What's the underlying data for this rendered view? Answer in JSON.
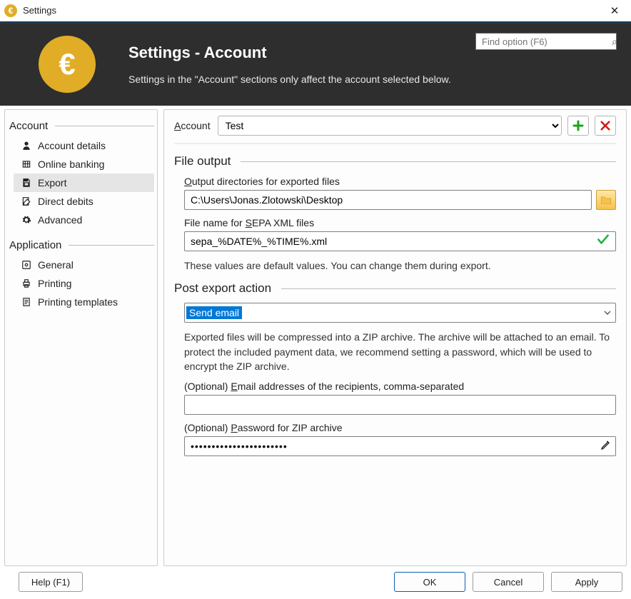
{
  "window": {
    "title": "Settings",
    "close_glyph": "✕"
  },
  "header": {
    "coin_glyph": "€",
    "title": "Settings - Account",
    "description": "Settings in the \"Account\" sections only affect the account selected below.",
    "find_placeholder": "Find option (F6)"
  },
  "sidebar": {
    "group_account": "Account",
    "group_application": "Application",
    "items_account": [
      {
        "label": "Account details"
      },
      {
        "label": "Online banking"
      },
      {
        "label": "Export"
      },
      {
        "label": "Direct debits"
      },
      {
        "label": "Advanced"
      }
    ],
    "items_application": [
      {
        "label": "General"
      },
      {
        "label": "Printing"
      },
      {
        "label": "Printing templates"
      }
    ]
  },
  "content": {
    "account_label_prefix": "A",
    "account_label_rest": "ccount",
    "account_selected": "Test",
    "section_file_output": "File output",
    "output_dir_label_pre": "O",
    "output_dir_label_rest": "utput directories for exported files",
    "output_dir_value": "C:\\Users\\Jonas.Zlotowski\\Desktop",
    "sepa_label_pre": "File name for ",
    "sepa_label_ul": "S",
    "sepa_label_rest": "EPA XML files",
    "sepa_value": "sepa_%DATE%_%TIME%.xml",
    "defaults_note": "These values are default values. You can change them during export.",
    "section_post_export": "Post export action",
    "post_action_value": "Send email",
    "post_action_desc": "Exported files will be compressed into a ZIP archive. The archive will be attached to an email. To protect the included payment data, we recommend setting a password, which will be used to encrypt the ZIP archive.",
    "email_label_pre": "(Optional) ",
    "email_label_ul": "E",
    "email_label_rest": "mail addresses of the recipients, comma-separated",
    "email_value": "",
    "pw_label_pre": "(Optional) ",
    "pw_label_ul": "P",
    "pw_label_rest": "assword for ZIP archive",
    "pw_value": "•••••••••••••••••••••••"
  },
  "footer": {
    "help": "Help (F1)",
    "ok": "OK",
    "cancel": "Cancel",
    "apply": "Apply"
  },
  "icons": {
    "add_plus": "+",
    "delete_x": "✕",
    "folder": "📁",
    "pencil": "✎",
    "check": "✓",
    "magnifier": "⌕",
    "chevron_down": "▾"
  }
}
